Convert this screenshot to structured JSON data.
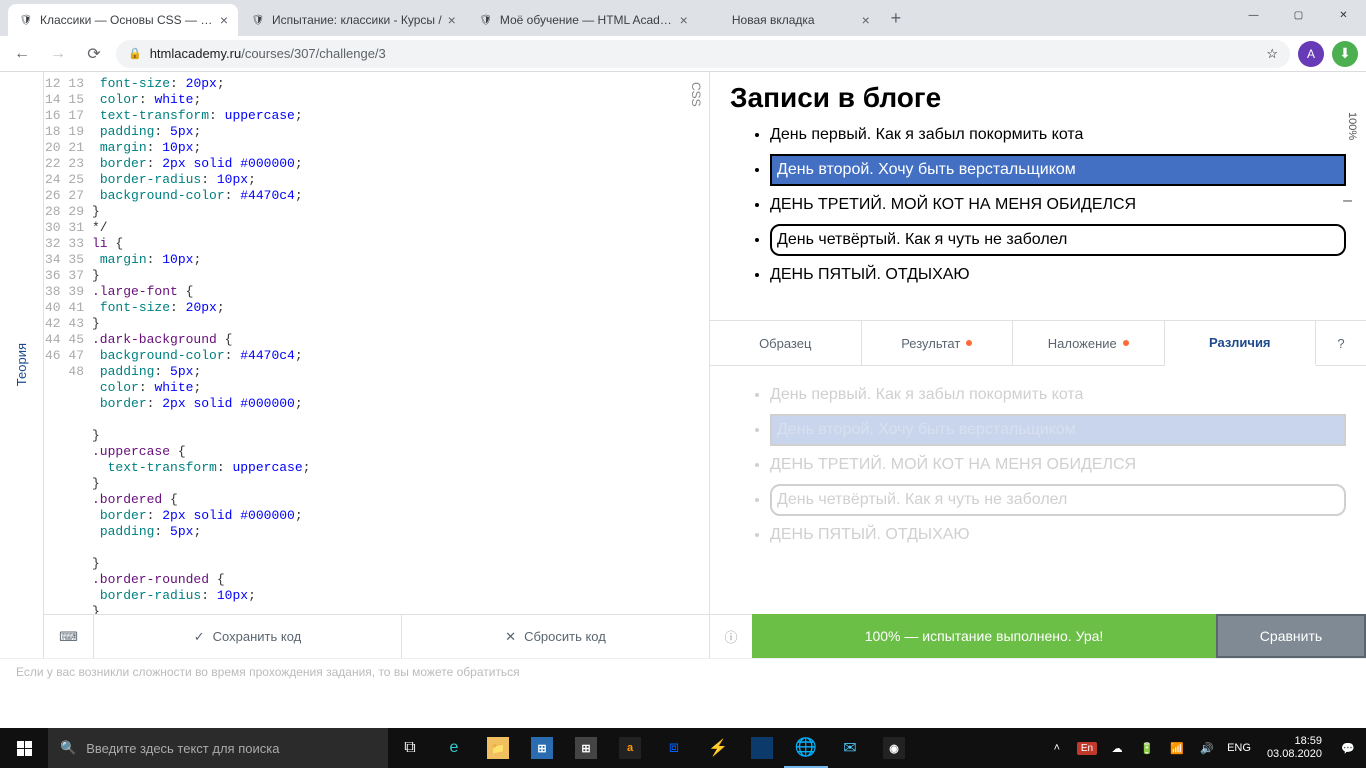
{
  "window": {
    "min": "—",
    "max": "▢",
    "close": "✕"
  },
  "tabs": [
    {
      "title": "Классики — Основы CSS — HTM",
      "active": true,
      "fav": "🛡"
    },
    {
      "title": "Испытание: классики - Курсы / ",
      "active": false,
      "fav": "🛡"
    },
    {
      "title": "Моё обучение — HTML Academ",
      "active": false,
      "fav": "🛡"
    },
    {
      "title": "Новая вкладка",
      "active": false,
      "fav": ""
    }
  ],
  "url": {
    "domain": "htmlacademy.ru",
    "path": "/courses/307/challenge/3"
  },
  "avatar": "A",
  "theory": "Теория",
  "cssLabel": "CSS",
  "code": {
    "start": 12,
    "lines": [
      [
        [
          " ",
          "p"
        ],
        [
          "font-size",
          "pr"
        ],
        [
          ": ",
          "p"
        ],
        [
          "20px",
          "v"
        ],
        [
          ";",
          "p"
        ]
      ],
      [
        [
          " ",
          "p"
        ],
        [
          "color",
          "pr"
        ],
        [
          ": ",
          "p"
        ],
        [
          "white",
          "v"
        ],
        [
          ";",
          "p"
        ]
      ],
      [
        [
          " ",
          "p"
        ],
        [
          "text-transform",
          "pr"
        ],
        [
          ": ",
          "p"
        ],
        [
          "uppercase",
          "v"
        ],
        [
          ";",
          "p"
        ]
      ],
      [
        [
          " ",
          "p"
        ],
        [
          "padding",
          "pr"
        ],
        [
          ": ",
          "p"
        ],
        [
          "5px",
          "v"
        ],
        [
          ";",
          "p"
        ]
      ],
      [
        [
          " ",
          "p"
        ],
        [
          "margin",
          "pr"
        ],
        [
          ": ",
          "p"
        ],
        [
          "10px",
          "v"
        ],
        [
          ";",
          "p"
        ]
      ],
      [
        [
          " ",
          "p"
        ],
        [
          "border",
          "pr"
        ],
        [
          ": ",
          "p"
        ],
        [
          "2px solid #000000",
          "v"
        ],
        [
          ";",
          "p"
        ]
      ],
      [
        [
          " ",
          "p"
        ],
        [
          "border-radius",
          "pr"
        ],
        [
          ": ",
          "p"
        ],
        [
          "10px",
          "v"
        ],
        [
          ";",
          "p"
        ]
      ],
      [
        [
          " ",
          "p"
        ],
        [
          "background-color",
          "pr"
        ],
        [
          ": ",
          "p"
        ],
        [
          "#4470c4",
          "v"
        ],
        [
          ";",
          "p"
        ]
      ],
      [
        [
          "}",
          "p"
        ]
      ],
      [
        [
          "*/",
          "p"
        ]
      ],
      [
        [
          "li ",
          "s"
        ],
        [
          "{",
          "p"
        ]
      ],
      [
        [
          " ",
          "p"
        ],
        [
          "margin",
          "pr"
        ],
        [
          ": ",
          "p"
        ],
        [
          "10px",
          "v"
        ],
        [
          ";",
          "p"
        ]
      ],
      [
        [
          "}",
          "p"
        ]
      ],
      [
        [
          ".large-font ",
          "s"
        ],
        [
          "{",
          "p"
        ]
      ],
      [
        [
          " ",
          "p"
        ],
        [
          "font-size",
          "pr"
        ],
        [
          ": ",
          "p"
        ],
        [
          "20px",
          "v"
        ],
        [
          ";",
          "p"
        ]
      ],
      [
        [
          "}",
          "p"
        ]
      ],
      [
        [
          ".dark-background ",
          "s"
        ],
        [
          "{",
          "p"
        ]
      ],
      [
        [
          " ",
          "p"
        ],
        [
          "background-color",
          "pr"
        ],
        [
          ": ",
          "p"
        ],
        [
          "#4470c4",
          "v"
        ],
        [
          ";",
          "p"
        ]
      ],
      [
        [
          " ",
          "p"
        ],
        [
          "padding",
          "pr"
        ],
        [
          ": ",
          "p"
        ],
        [
          "5px",
          "v"
        ],
        [
          ";",
          "p"
        ]
      ],
      [
        [
          " ",
          "p"
        ],
        [
          "color",
          "pr"
        ],
        [
          ": ",
          "p"
        ],
        [
          "white",
          "v"
        ],
        [
          ";",
          "p"
        ]
      ],
      [
        [
          " ",
          "p"
        ],
        [
          "border",
          "pr"
        ],
        [
          ": ",
          "p"
        ],
        [
          "2px solid #000000",
          "v"
        ],
        [
          ";",
          "p"
        ]
      ],
      [
        [
          "",
          "p"
        ]
      ],
      [
        [
          "}",
          "p"
        ]
      ],
      [
        [
          ".uppercase ",
          "s"
        ],
        [
          "{",
          "p"
        ]
      ],
      [
        [
          "  ",
          "p"
        ],
        [
          "text-transform",
          "pr"
        ],
        [
          ": ",
          "p"
        ],
        [
          "uppercase",
          "v"
        ],
        [
          ";",
          "p"
        ]
      ],
      [
        [
          "}",
          "p"
        ]
      ],
      [
        [
          ".bordered ",
          "s"
        ],
        [
          "{",
          "p"
        ]
      ],
      [
        [
          " ",
          "p"
        ],
        [
          "border",
          "pr"
        ],
        [
          ": ",
          "p"
        ],
        [
          "2px solid #000000",
          "v"
        ],
        [
          ";",
          "p"
        ]
      ],
      [
        [
          " ",
          "p"
        ],
        [
          "padding",
          "pr"
        ],
        [
          ": ",
          "p"
        ],
        [
          "5px",
          "v"
        ],
        [
          ";",
          "p"
        ]
      ],
      [
        [
          "",
          "p"
        ]
      ],
      [
        [
          "}",
          "p"
        ]
      ],
      [
        [
          ".border-rounded ",
          "s"
        ],
        [
          "{",
          "p"
        ]
      ],
      [
        [
          " ",
          "p"
        ],
        [
          "border-radius",
          "pr"
        ],
        [
          ": ",
          "p"
        ],
        [
          "10px",
          "v"
        ],
        [
          ";",
          "p"
        ]
      ],
      [
        [
          "}",
          "p"
        ]
      ],
      [
        [
          "",
          "p"
        ]
      ],
      [
        [
          "",
          "p"
        ]
      ],
      [
        [
          "",
          "p"
        ]
      ]
    ]
  },
  "editorActions": {
    "keyboard": "⌨",
    "save": "Сохранить код",
    "reset": "Сбросить код"
  },
  "preview": {
    "zoom": "100%",
    "title": "Записи в блоге",
    "items": [
      {
        "text": "День первый. Как я забыл покормить кота",
        "cls": ""
      },
      {
        "text": "День второй. Хочу быть верстальщиком",
        "cls": "dark"
      },
      {
        "text": "ДЕНЬ ТРЕТИЙ. МОЙ КОТ НА МЕНЯ ОБИДЕЛСЯ",
        "cls": ""
      },
      {
        "text": "День четвёртый. Как я чуть не заболел",
        "cls": "bordered"
      },
      {
        "text": "ДЕНЬ ПЯТЫЙ. ОТДЫХАЮ",
        "cls": ""
      }
    ]
  },
  "cmpTabs": [
    {
      "label": "Образец",
      "dot": false,
      "active": false
    },
    {
      "label": "Результат",
      "dot": true,
      "active": false
    },
    {
      "label": "Наложение",
      "dot": true,
      "active": false
    },
    {
      "label": "Различия",
      "dot": false,
      "active": true
    }
  ],
  "help": "?",
  "result": {
    "msg": "100% — испытание выполнено. Ура!",
    "compare": "Сравнить",
    "info": "ⓘ"
  },
  "hint": "Если у вас возникли сложности во время прохождения задания, то вы можете обратиться",
  "taskbar": {
    "search": "Введите здесь текст для поиска",
    "lang": "ENG",
    "langBadge": "En",
    "time": "18:59",
    "date": "03.08.2020"
  }
}
